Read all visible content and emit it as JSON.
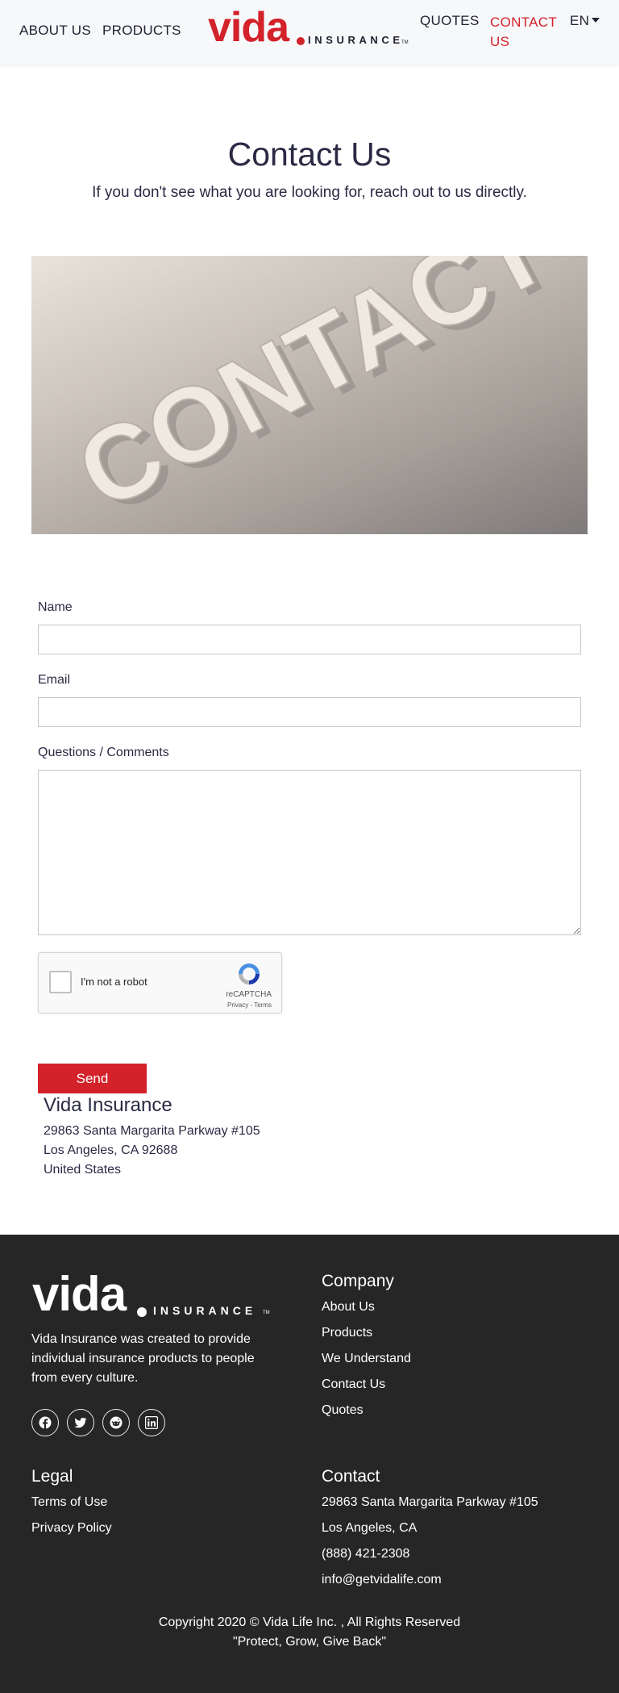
{
  "nav": {
    "about": "ABOUT US",
    "products": "PRODUCTS",
    "quotes": "QUOTES",
    "contact": "CONTACT US",
    "lang": "EN",
    "logo_word": "vida",
    "logo_sub": "INSURANCE",
    "logo_tm": "TM"
  },
  "hero": {
    "title": "Contact Us",
    "subtitle": "If you don't see what you are looking for, reach out to us directly.",
    "image_word": "CONTACT"
  },
  "form": {
    "name_label": "Name",
    "name_value": "",
    "email_label": "Email",
    "email_value": "",
    "comments_label": "Questions / Comments",
    "comments_value": "",
    "captcha_text": "I'm not a robot",
    "captcha_brand": "reCAPTCHA",
    "captcha_legal": "Privacy - Terms",
    "send_label": "Send"
  },
  "address": {
    "title": "Vida Insurance",
    "line1": "29863 Santa Margarita Parkway #105",
    "line2": "Los Angeles, CA 92688",
    "line3": "United States"
  },
  "footer": {
    "logo_word": "vida",
    "logo_sub": "INSURANCE",
    "logo_tm": "TM",
    "description": "Vida Insurance was created to provide individual insurance products to people from every culture.",
    "social": [
      "facebook-icon",
      "twitter-icon",
      "reddit-icon",
      "linkedin-icon"
    ],
    "company": {
      "heading": "Company",
      "links": [
        "About Us",
        "Products",
        "We Understand",
        "Contact Us",
        "Quotes"
      ]
    },
    "legal": {
      "heading": "Legal",
      "links": [
        "Terms of Use",
        "Privacy Policy"
      ]
    },
    "contact": {
      "heading": "Contact",
      "lines": [
        "29863 Santa Margarita Parkway #105",
        "Los Angeles, CA",
        "(888) 421-2308",
        "info@getvidalife.com"
      ]
    },
    "copyright": "Copyright 2020 © Vida Life Inc. , All Rights Reserved",
    "tagline": "\"Protect, Grow, Give Back\""
  },
  "colors": {
    "brand_red": "#d3222a",
    "text_dark": "#2a2a45",
    "footer_bg": "#262626"
  }
}
